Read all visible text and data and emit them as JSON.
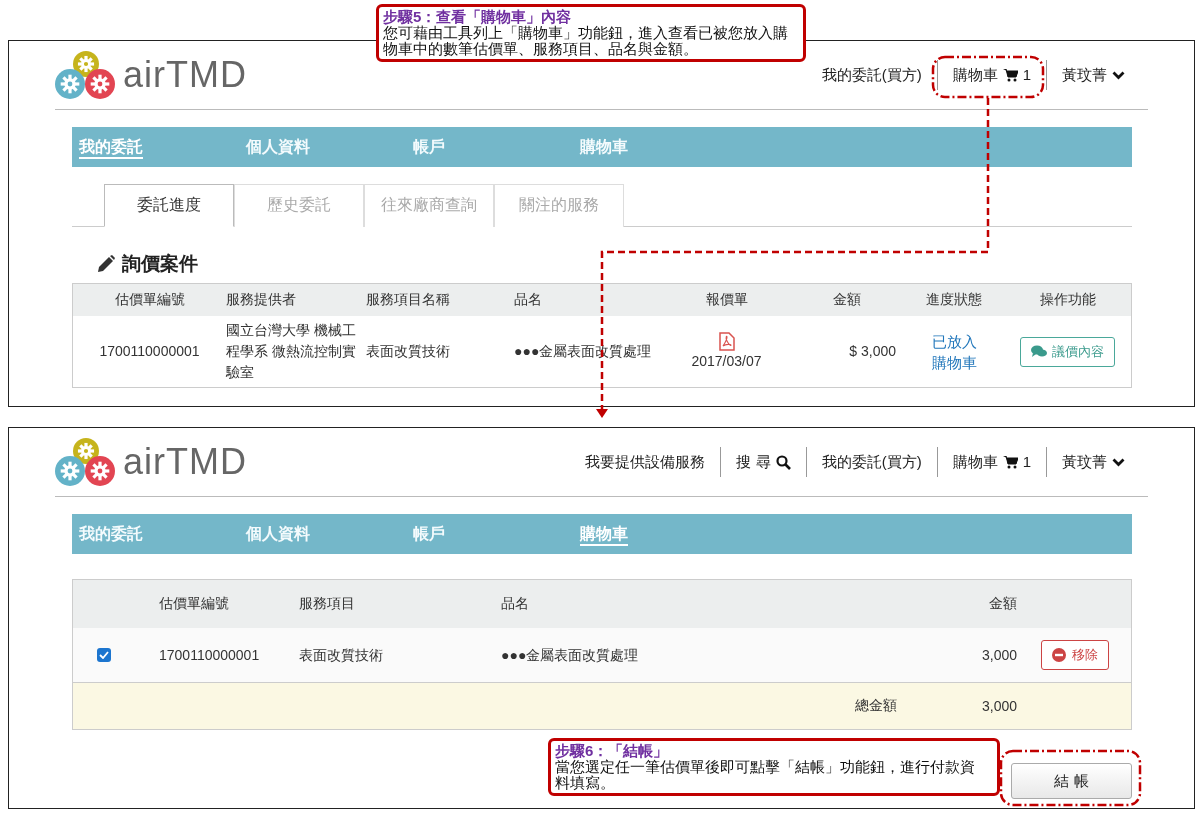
{
  "screens": [
    {
      "logo": "airTMD",
      "nav": [
        {
          "kind": "link",
          "label": "我的委託(買方)"
        },
        {
          "kind": "cart",
          "label": "購物車",
          "count": "1"
        },
        {
          "kind": "user",
          "label": "黃玟菁"
        }
      ],
      "main_tabs": [
        {
          "label": "我的委託",
          "selected": true
        },
        {
          "label": "個人資料",
          "selected": false
        },
        {
          "label": "帳戶",
          "selected": false
        },
        {
          "label": "購物車",
          "selected": false
        }
      ],
      "sub_tabs": [
        {
          "label": "委託進度",
          "selected": true
        },
        {
          "label": "歷史委託",
          "selected": false
        },
        {
          "label": "往來廠商查詢",
          "selected": false
        },
        {
          "label": "關注的服務",
          "selected": false
        }
      ],
      "section_title": "詢價案件",
      "inquiry_table": {
        "columns": [
          "估價單編號",
          "服務提供者",
          "服務項目名稱",
          "品名",
          "報價單",
          "金額",
          "進度狀態",
          "操作功能"
        ],
        "rows": [
          {
            "id": "1700110000001",
            "provider": "國立台灣大學 機械工程學系 微熱流控制實驗室",
            "service": "表面改質技術",
            "item": "●●●金屬表面改質處理",
            "quote_date": "2017/03/07",
            "amount": "$ 3,000",
            "status": "已放入購物車",
            "action": "議價內容"
          }
        ]
      }
    },
    {
      "logo": "airTMD",
      "nav": [
        {
          "kind": "link",
          "label": "我要提供設備服務"
        },
        {
          "kind": "search",
          "label": "搜 尋"
        },
        {
          "kind": "link",
          "label": "我的委託(買方)"
        },
        {
          "kind": "cart",
          "label": "購物車",
          "count": "1"
        },
        {
          "kind": "user",
          "label": "黃玟菁"
        }
      ],
      "main_tabs": [
        {
          "label": "我的委託",
          "selected": false
        },
        {
          "label": "個人資料",
          "selected": false
        },
        {
          "label": "帳戶",
          "selected": false
        },
        {
          "label": "購物車",
          "selected": true
        }
      ],
      "cart_table": {
        "columns": [
          "估價單編號",
          "服務項目",
          "品名",
          "金額"
        ],
        "rows": [
          {
            "checked": true,
            "id": "1700110000001",
            "service": "表面改質技術",
            "item": "●●●金屬表面改質處理",
            "amount": "3,000",
            "remove": "移除"
          }
        ],
        "total_label": "總金額",
        "total": "3,000"
      },
      "checkout": "結 帳"
    }
  ],
  "callouts": [
    {
      "title": "步驟5：查看「購物車」內容",
      "body": "您可藉由工具列上「購物車」功能鈕，進入查看已被您放入購物車中的數筆估價單、服務項目、品名與金額。"
    },
    {
      "title": "步驟6：「結帳」",
      "body": "當您選定任一筆估價單後即可點擊「結帳」功能鈕，進行付款資料填寫。"
    }
  ]
}
